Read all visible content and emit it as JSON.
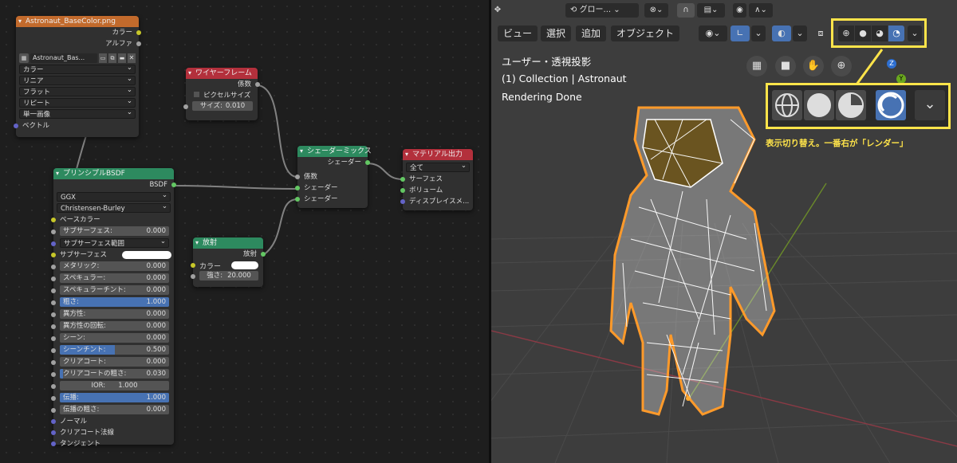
{
  "nodes": {
    "image": {
      "title": "Astronaut_BaseColor.png",
      "out_color": "カラー",
      "out_alpha": "アルファ",
      "image_name": "Astronaut_Bas...",
      "color_space": "カラー",
      "interp": "リニア",
      "proj": "フラット",
      "ext": "リピート",
      "source": "単一画像",
      "vector": "ベクトル"
    },
    "wire": {
      "title": "ワイヤーフレーム",
      "out": "係数",
      "pixel_size_label": "ピクセルサイズ",
      "size_label": "サイズ:",
      "size_value": "0.010"
    },
    "mix": {
      "title": "シェーダーミックス",
      "out": "シェーダー",
      "fac": "係数",
      "in1": "シェーダー",
      "in2": "シェーダー"
    },
    "out": {
      "title": "マテリアル出力",
      "target": "全て",
      "surface": "サーフェス",
      "volume": "ボリューム",
      "disp": "ディスプレイスメ..."
    },
    "emit": {
      "title": "放射",
      "out": "放射",
      "color": "カラー",
      "strength_label": "強さ:",
      "strength_value": "20.000"
    },
    "bsdf": {
      "title": "プリンシプルBSDF",
      "out": "BSDF",
      "dist": "GGX",
      "sss_method": "Christensen-Burley",
      "base_color": "ベースカラー",
      "fields": [
        {
          "label": "サブサーフェス:",
          "value": "0.000",
          "fill": 0
        },
        {
          "label": "サブサーフェス範囲",
          "value": "",
          "dropdown": true
        },
        {
          "label": "サブサーフェス",
          "value": "",
          "swatch": true
        },
        {
          "label": "メタリック:",
          "value": "0.000",
          "fill": 0
        },
        {
          "label": "スペキュラー:",
          "value": "0.000",
          "fill": 0
        },
        {
          "label": "スペキュラーチント:",
          "value": "0.000",
          "fill": 0
        },
        {
          "label": "粗さ:",
          "value": "1.000",
          "fill": 1
        },
        {
          "label": "異方性:",
          "value": "0.000",
          "fill": 0
        },
        {
          "label": "異方性の回転:",
          "value": "0.000",
          "fill": 0
        },
        {
          "label": "シーン:",
          "value": "0.000",
          "fill": 0
        },
        {
          "label": "シーンチント:",
          "value": "0.500",
          "fill": 0.5
        },
        {
          "label": "クリアコート:",
          "value": "0.000",
          "fill": 0
        },
        {
          "label": "クリアコートの粗さ:",
          "value": "0.030",
          "fill": 0.03
        },
        {
          "label": "IOR:",
          "value": "1.000",
          "fill": 0,
          "center": true
        },
        {
          "label": "伝播:",
          "value": "1.000",
          "fill": 1
        },
        {
          "label": "伝播の粗さ:",
          "value": "0.000",
          "fill": 0
        }
      ],
      "normal": "ノーマル",
      "cc_normal": "クリアコート法線",
      "tangent": "タンジェント"
    }
  },
  "viewport": {
    "top_dropdown": "グロー...",
    "menus": [
      "ビュー",
      "選択",
      "追加",
      "オブジェクト"
    ],
    "overlay_lines": [
      "ユーザー・透視投影",
      "(1) Collection | Astronaut",
      "Rendering Done"
    ],
    "axis_z": "Z",
    "axis_y": "Y",
    "callout": "表示切り替え。一番右が「レンダー」"
  }
}
